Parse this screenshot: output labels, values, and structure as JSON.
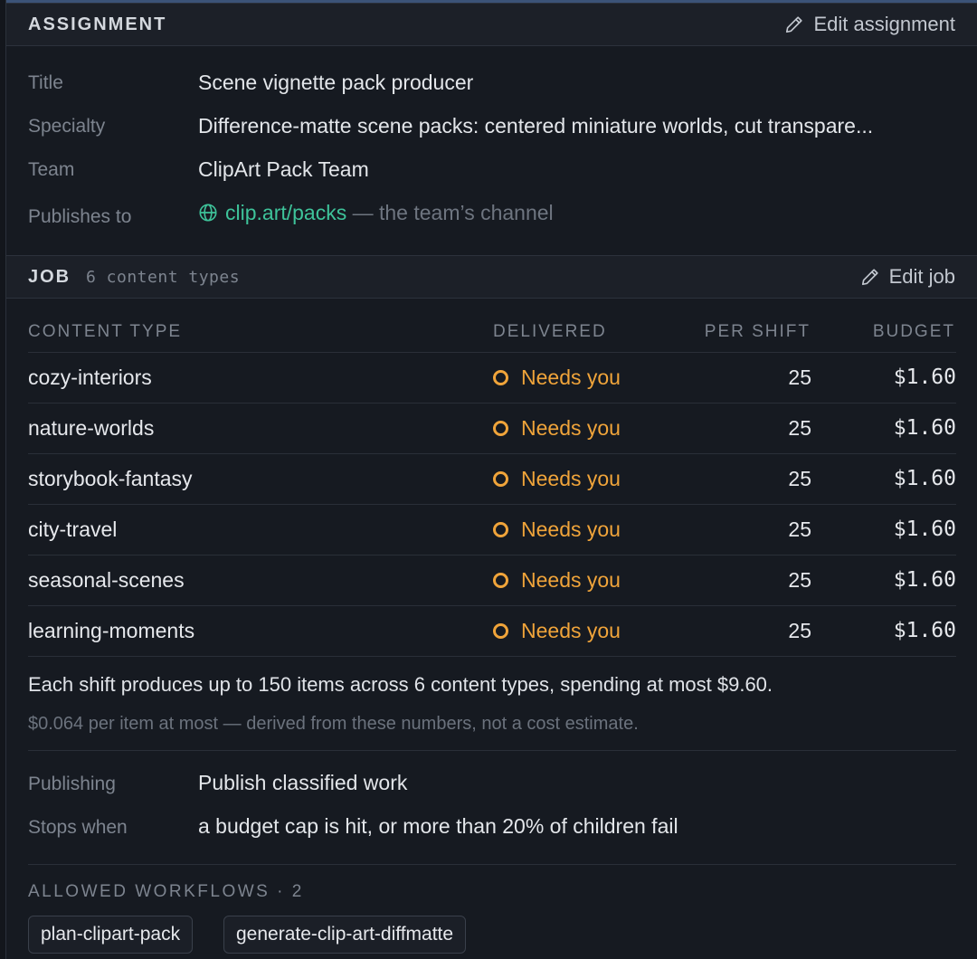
{
  "assignment": {
    "header": "ASSIGNMENT",
    "edit_label": "Edit assignment",
    "title_label": "Title",
    "title_value": "Scene vignette pack producer",
    "specialty_label": "Specialty",
    "specialty_value": "Difference-matte scene packs: centered miniature worlds, cut transpare...",
    "team_label": "Team",
    "team_value": "ClipArt Pack Team",
    "publishes_label": "Publishes to",
    "publishes_link": "clip.art/packs",
    "publishes_note": "— the team’s channel"
  },
  "job": {
    "header": "JOB",
    "subheader": "6 content types",
    "edit_label": "Edit job",
    "columns": {
      "type": "CONTENT TYPE",
      "delivered": "DELIVERED",
      "per_shift": "PER SHIFT",
      "budget": "BUDGET"
    },
    "rows": [
      {
        "name": "cozy-interiors",
        "status": "Needs you",
        "per_shift": "25",
        "budget": "$1.60"
      },
      {
        "name": "nature-worlds",
        "status": "Needs you",
        "per_shift": "25",
        "budget": "$1.60"
      },
      {
        "name": "storybook-fantasy",
        "status": "Needs you",
        "per_shift": "25",
        "budget": "$1.60"
      },
      {
        "name": "city-travel",
        "status": "Needs you",
        "per_shift": "25",
        "budget": "$1.60"
      },
      {
        "name": "seasonal-scenes",
        "status": "Needs you",
        "per_shift": "25",
        "budget": "$1.60"
      },
      {
        "name": "learning-moments",
        "status": "Needs you",
        "per_shift": "25",
        "budget": "$1.60"
      }
    ],
    "summary": "Each shift produces up to 150 items across 6 content types, spending at most $9.60.",
    "derived_note": "$0.064 per item at most — derived from these numbers, not a cost estimate.",
    "publishing_label": "Publishing",
    "publishing_value": "Publish classified work",
    "stops_label": "Stops when",
    "stops_value": "a budget cap is hit, or more than 20% of children fail",
    "workflows_header": "ALLOWED WORKFLOWS · 2",
    "workflows": [
      "plan-clipart-pack",
      "generate-clip-art-diffmatte"
    ]
  },
  "colors": {
    "accent_link": "#3ec39a",
    "status_warning": "#f0a43a",
    "background": "#161a21"
  },
  "icons": {
    "edit": "pencil-icon",
    "publish": "globe-icon",
    "status": "ring-dot-icon"
  }
}
